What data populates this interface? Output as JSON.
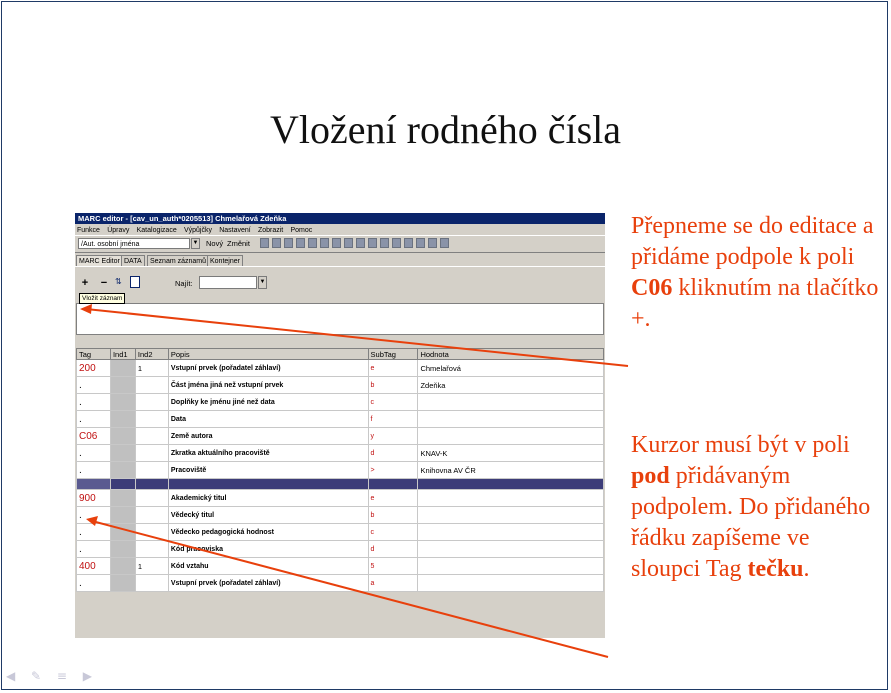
{
  "slide": {
    "title": "Vložení rodného čísla",
    "note1_a": "Přepneme se do editace a přidáme podpole k poli ",
    "note1_b": "C06",
    "note1_c": " kliknutím na tlačítko +.",
    "note2_a": "Kurzor musí být v poli ",
    "note2_b": "pod",
    "note2_c": " přidávaným podpolem. Do přidaného řádku zapíšeme ve sloupci Tag ",
    "note2_d": "tečku",
    "note2_e": ".",
    "accent_color": "#e8400c",
    "nav_icons": "◀ ✎ ≡ ▶"
  },
  "window": {
    "title": "MARC editor - [cav_un_auth*0205513] Chmelařová Zdeňka",
    "menu": [
      "Funkce",
      "Úpravy",
      "Katalogizace",
      "Výpůjčky",
      "Nastavení",
      "Zobrazit",
      "Pomoc"
    ],
    "combo_value": "/Aut. osobní jména",
    "new_label": "Nový",
    "change_label": "Změnit",
    "tabs": [
      "MARC Editor",
      "DATA",
      "Seznam záznamů",
      "Kontejner"
    ],
    "plus_label": "+",
    "minus_label": "−",
    "find_label": "Najít:",
    "tooltip": "Vložit záznam"
  },
  "grid": {
    "headers": [
      "Tag",
      "Ind1",
      "Ind2",
      "Popis",
      "SubTag",
      "Hodnota"
    ],
    "rows": [
      {
        "tag": "200",
        "ind1": "",
        "ind2": "1",
        "popis": "Vstupní prvek (pořadatel záhlaví)",
        "subtag": "e",
        "hodnota": "Chmelařová"
      },
      {
        "tag": ".",
        "ind1": "",
        "ind2": "",
        "popis": "Část jména jiná než vstupní prvek",
        "subtag": "b",
        "hodnota": "Zdeňka"
      },
      {
        "tag": ".",
        "ind1": "",
        "ind2": "",
        "popis": "Doplňky ke jménu jiné než data",
        "subtag": "c",
        "hodnota": ""
      },
      {
        "tag": ".",
        "ind1": "",
        "ind2": "",
        "popis": "Data",
        "subtag": "f",
        "hodnota": ""
      },
      {
        "tag": "C06",
        "ind1": "",
        "ind2": "",
        "popis": "Země autora",
        "subtag": "y",
        "hodnota": ""
      },
      {
        "tag": ".",
        "ind1": "",
        "ind2": "",
        "popis": "Zkratka aktuálního pracoviště",
        "subtag": "d",
        "hodnota": "KNAV-K"
      },
      {
        "tag": ".",
        "ind1": "",
        "ind2": "",
        "popis": "Pracoviště",
        "subtag": ">",
        "hodnota": "Knihovna AV ČR"
      },
      {
        "tag": "",
        "ind1": "",
        "ind2": "",
        "popis": "",
        "subtag": "",
        "hodnota": "",
        "selected": true
      },
      {
        "tag": "900",
        "ind1": "",
        "ind2": "",
        "popis": "Akademický titul",
        "subtag": "e",
        "hodnota": ""
      },
      {
        "tag": ".",
        "ind1": "",
        "ind2": "",
        "popis": "Vědecký titul",
        "subtag": "b",
        "hodnota": ""
      },
      {
        "tag": ".",
        "ind1": "",
        "ind2": "",
        "popis": "Vědecko pedagogická hodnost",
        "subtag": "c",
        "hodnota": ""
      },
      {
        "tag": ".",
        "ind1": "",
        "ind2": "",
        "popis": "Kód pracoviska",
        "subtag": "d",
        "hodnota": ""
      },
      {
        "tag": "400",
        "ind1": "",
        "ind2": "1",
        "popis": "Kód vztahu",
        "subtag": "5",
        "hodnota": ""
      },
      {
        "tag": ".",
        "ind1": "",
        "ind2": "",
        "popis": "Vstupní prvek (pořadatel záhlaví)",
        "subtag": "a",
        "hodnota": ""
      }
    ]
  }
}
